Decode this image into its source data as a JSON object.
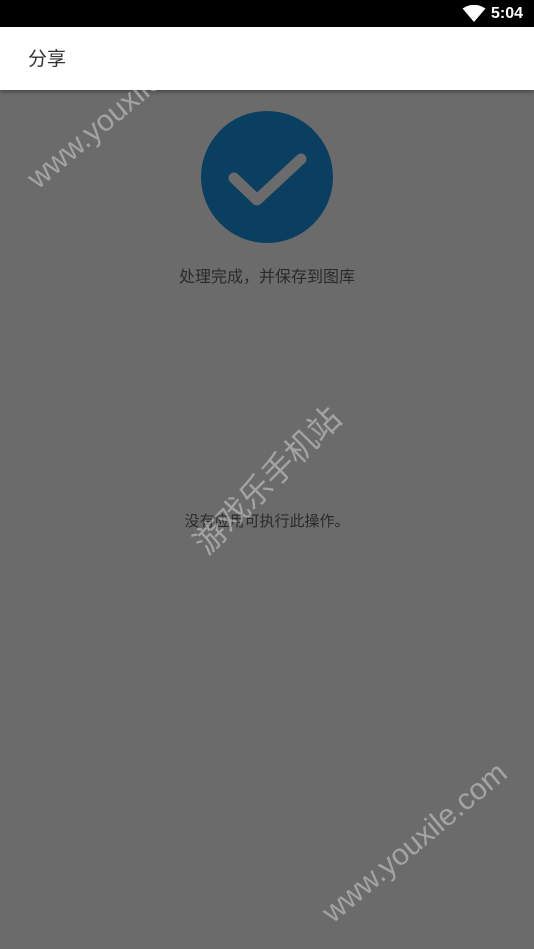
{
  "status_bar": {
    "time": "5:04",
    "wifi_icon": "wifi-icon"
  },
  "app_bar": {
    "title": "分享"
  },
  "main": {
    "success_icon": "checkmark-icon",
    "status_text": "处理完成，并保存到图库",
    "empty_text": "没有应用可执行此操作。"
  },
  "watermarks": {
    "top": "www.youxile.com",
    "middle": "游戏乐手机站",
    "bottom": "www.youxile.com"
  },
  "colors": {
    "status_bar_bg": "#000000",
    "app_bar_bg": "#ffffff",
    "scrim_bg": "#6b6b6b",
    "success_circle": "#0a3f61",
    "checkmark": "#6b6b6b"
  }
}
